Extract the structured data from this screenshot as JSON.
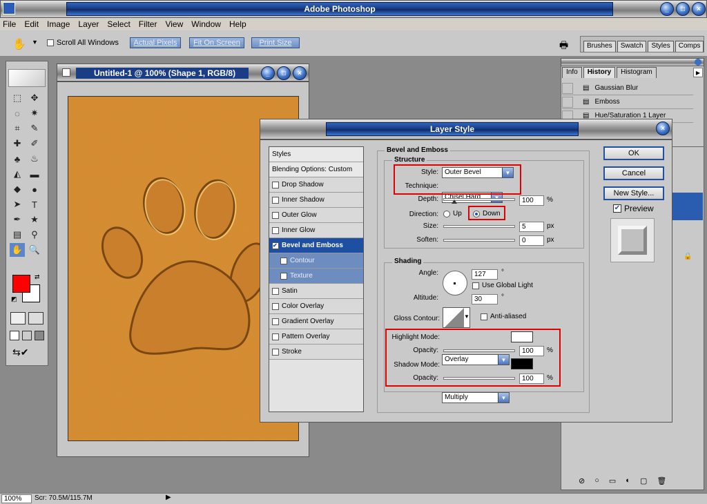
{
  "app": {
    "title": "Adobe Photoshop"
  },
  "menu": [
    "File",
    "Edit",
    "Image",
    "Layer",
    "Select",
    "Filter",
    "View",
    "Window",
    "Help"
  ],
  "options_bar": {
    "scroll_all_label": "Scroll All Windows",
    "actual_pixels": "Actual Pixels",
    "fit_on_screen": "Fit On Screen",
    "print_size": "Print Size",
    "palette_tabs": [
      "Brushes",
      "Swatch",
      "Styles",
      "Comps"
    ]
  },
  "colors": {
    "foreground": "#ff0000",
    "background": "#ffffff",
    "canvas": "#d98a2e",
    "accent": "#1f4fa3"
  },
  "document": {
    "title": "Untitled-1 @ 100% (Shape 1, RGB/8)"
  },
  "history_palette": {
    "tabs": [
      "Info",
      "History",
      "Histogram"
    ],
    "items": [
      "Gaussian Blur",
      "Emboss",
      "Hue/Saturation 1 Layer"
    ]
  },
  "status": {
    "zoom": "100%",
    "scratch": "Scr: 70.5M/115.7M"
  },
  "dialog": {
    "title": "Layer Style",
    "styles_header": "Styles",
    "blending": "Blending Options: Custom",
    "style_list": [
      {
        "label": "Drop Shadow",
        "checked": false
      },
      {
        "label": "Inner Shadow",
        "checked": false
      },
      {
        "label": "Outer Glow",
        "checked": false
      },
      {
        "label": "Inner Glow",
        "checked": false
      },
      {
        "label": "Bevel and Emboss",
        "checked": true
      },
      {
        "label": "Contour",
        "checked": false
      },
      {
        "label": "Texture",
        "checked": false
      },
      {
        "label": "Satin",
        "checked": false
      },
      {
        "label": "Color Overlay",
        "checked": false
      },
      {
        "label": "Gradient Overlay",
        "checked": false
      },
      {
        "label": "Pattern Overlay",
        "checked": false
      },
      {
        "label": "Stroke",
        "checked": false
      }
    ],
    "section_title": "Bevel and Emboss",
    "structure": {
      "title": "Structure",
      "style_label": "Style:",
      "style_value": "Outer Bevel",
      "technique_label": "Technique:",
      "technique_value": "Chisel Hard",
      "depth_label": "Depth:",
      "depth_value": "100",
      "depth_unit": "%",
      "direction_label": "Direction:",
      "up": "Up",
      "down": "Down",
      "size_label": "Size:",
      "size_value": "5",
      "size_unit": "px",
      "soften_label": "Soften:",
      "soften_value": "0",
      "soften_unit": "px"
    },
    "shading": {
      "title": "Shading",
      "angle_label": "Angle:",
      "angle_value": "127",
      "angle_unit": "°",
      "global_light": "Use Global Light",
      "altitude_label": "Altitude:",
      "altitude_value": "30",
      "altitude_unit": "°",
      "gloss_label": "Gloss Contour:",
      "anti_aliased": "Anti-aliased",
      "highlight_label": "Highlight Mode:",
      "highlight_value": "Overlay",
      "highlight_color": "#ffffff",
      "h_opacity_label": "Opacity:",
      "h_opacity_value": "100",
      "h_opacity_unit": "%",
      "shadow_label": "Shadow Mode:",
      "shadow_value": "Multiply",
      "shadow_color": "#000000",
      "s_opacity_label": "Opacity:",
      "s_opacity_value": "100",
      "s_opacity_unit": "%"
    },
    "buttons": {
      "ok": "OK",
      "cancel": "Cancel",
      "new_style": "New Style...",
      "preview": "Preview"
    }
  }
}
